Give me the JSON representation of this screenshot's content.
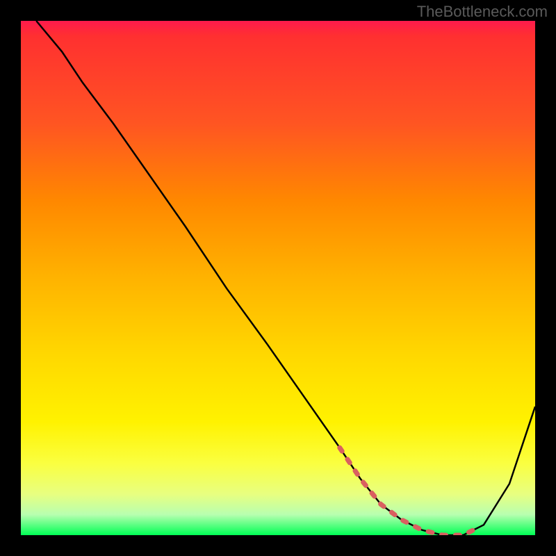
{
  "watermark": "TheBottleneck.com",
  "chart_data": {
    "type": "line",
    "title": "",
    "xlabel": "",
    "ylabel": "",
    "xlim": [
      0,
      100
    ],
    "ylim": [
      0,
      100
    ],
    "series": [
      {
        "name": "main-curve",
        "color": "#000000",
        "x": [
          3,
          8,
          12,
          18,
          25,
          32,
          40,
          48,
          55,
          62,
          66,
          70,
          74,
          78,
          82,
          86,
          90,
          95,
          100
        ],
        "y": [
          100,
          94,
          88,
          80,
          70,
          60,
          48,
          37,
          27,
          17,
          11,
          6,
          3,
          1,
          0,
          0,
          2,
          10,
          25
        ]
      },
      {
        "name": "accent-segment",
        "color": "#d96060",
        "x": [
          62,
          66,
          70,
          74,
          78,
          82,
          86,
          88
        ],
        "y": [
          17,
          11,
          6,
          3,
          1,
          0,
          0,
          1
        ]
      }
    ],
    "gradient_stops": [
      {
        "pos": 0,
        "color": "#ff1a4d"
      },
      {
        "pos": 0.03,
        "color": "#ff3030"
      },
      {
        "pos": 0.2,
        "color": "#ff5522"
      },
      {
        "pos": 0.35,
        "color": "#ff8800"
      },
      {
        "pos": 0.5,
        "color": "#ffb300"
      },
      {
        "pos": 0.65,
        "color": "#ffd800"
      },
      {
        "pos": 0.78,
        "color": "#fff200"
      },
      {
        "pos": 0.86,
        "color": "#faff40"
      },
      {
        "pos": 0.92,
        "color": "#e8ff80"
      },
      {
        "pos": 0.96,
        "color": "#b8ffb0"
      },
      {
        "pos": 1.0,
        "color": "#00ff55"
      }
    ]
  }
}
